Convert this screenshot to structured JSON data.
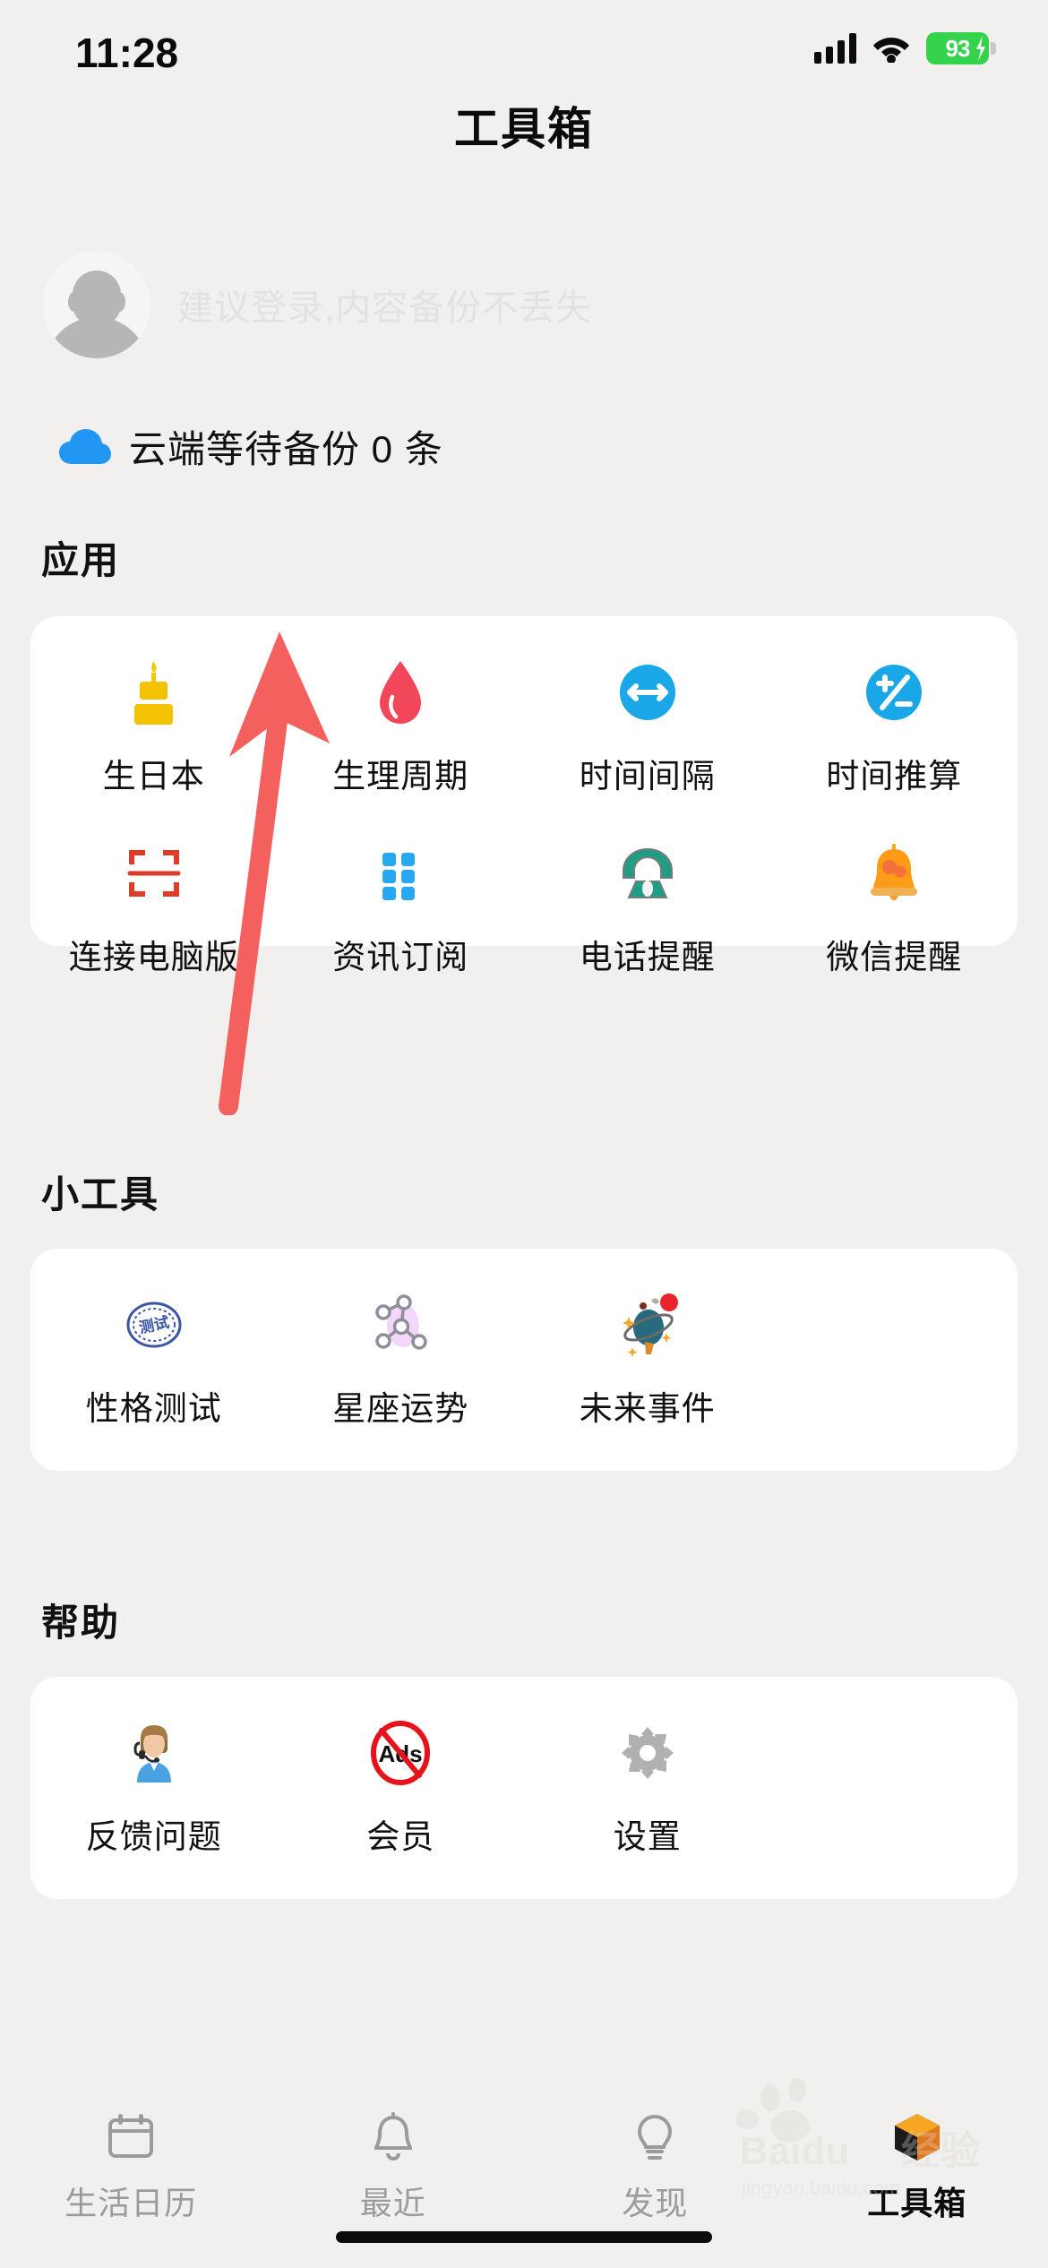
{
  "status_bar": {
    "time": "11:28",
    "battery_percent": "93",
    "icons": [
      "signal-icon",
      "wifi-icon",
      "battery-charging-icon"
    ]
  },
  "header": {
    "title": "工具箱"
  },
  "profile": {
    "avatar_icon": "avatar-placeholder-icon",
    "login_hint": "建议登录,内容备份不丢失"
  },
  "cloud_backup": {
    "icon": "cloud-icon",
    "text": "云端等待备份 0 条",
    "color": "#2196f3"
  },
  "sections": [
    {
      "title": "应用",
      "items": [
        {
          "label": "生日本",
          "icon": "birthday-cake-icon"
        },
        {
          "label": "生理周期",
          "icon": "blood-drop-icon"
        },
        {
          "label": "时间间隔",
          "icon": "arrows-horizontal-icon"
        },
        {
          "label": "时间推算",
          "icon": "plus-minus-icon"
        },
        {
          "label": "连接电脑版",
          "icon": "scan-frame-icon"
        },
        {
          "label": "资讯订阅",
          "icon": "dot-grid-icon"
        },
        {
          "label": "电话提醒",
          "icon": "telephone-icon"
        },
        {
          "label": "微信提醒",
          "icon": "bell-chat-icon"
        }
      ]
    },
    {
      "title": "小工具",
      "items": [
        {
          "label": "性格测试",
          "icon": "test-stamp-icon"
        },
        {
          "label": "星座运势",
          "icon": "constellation-icon"
        },
        {
          "label": "未来事件",
          "icon": "planet-icon"
        }
      ]
    },
    {
      "title": "帮助",
      "items": [
        {
          "label": "反馈问题",
          "icon": "support-agent-icon"
        },
        {
          "label": "会员",
          "icon": "no-ads-icon"
        },
        {
          "label": "设置",
          "icon": "gear-icon"
        }
      ]
    }
  ],
  "tab_bar": {
    "tabs": [
      {
        "label": "生活日历",
        "icon": "calendar-icon",
        "active": false
      },
      {
        "label": "最近",
        "icon": "bell-icon",
        "active": false
      },
      {
        "label": "发现",
        "icon": "lightbulb-icon",
        "active": false
      },
      {
        "label": "工具箱",
        "icon": "toolbox-cube-icon",
        "active": true
      }
    ]
  },
  "annotation": {
    "type": "arrow",
    "color": "#f4605e",
    "points_to": "生理周期"
  },
  "watermark": {
    "brand": "Baidu 经验",
    "url": "jingyan.baidu.com"
  }
}
